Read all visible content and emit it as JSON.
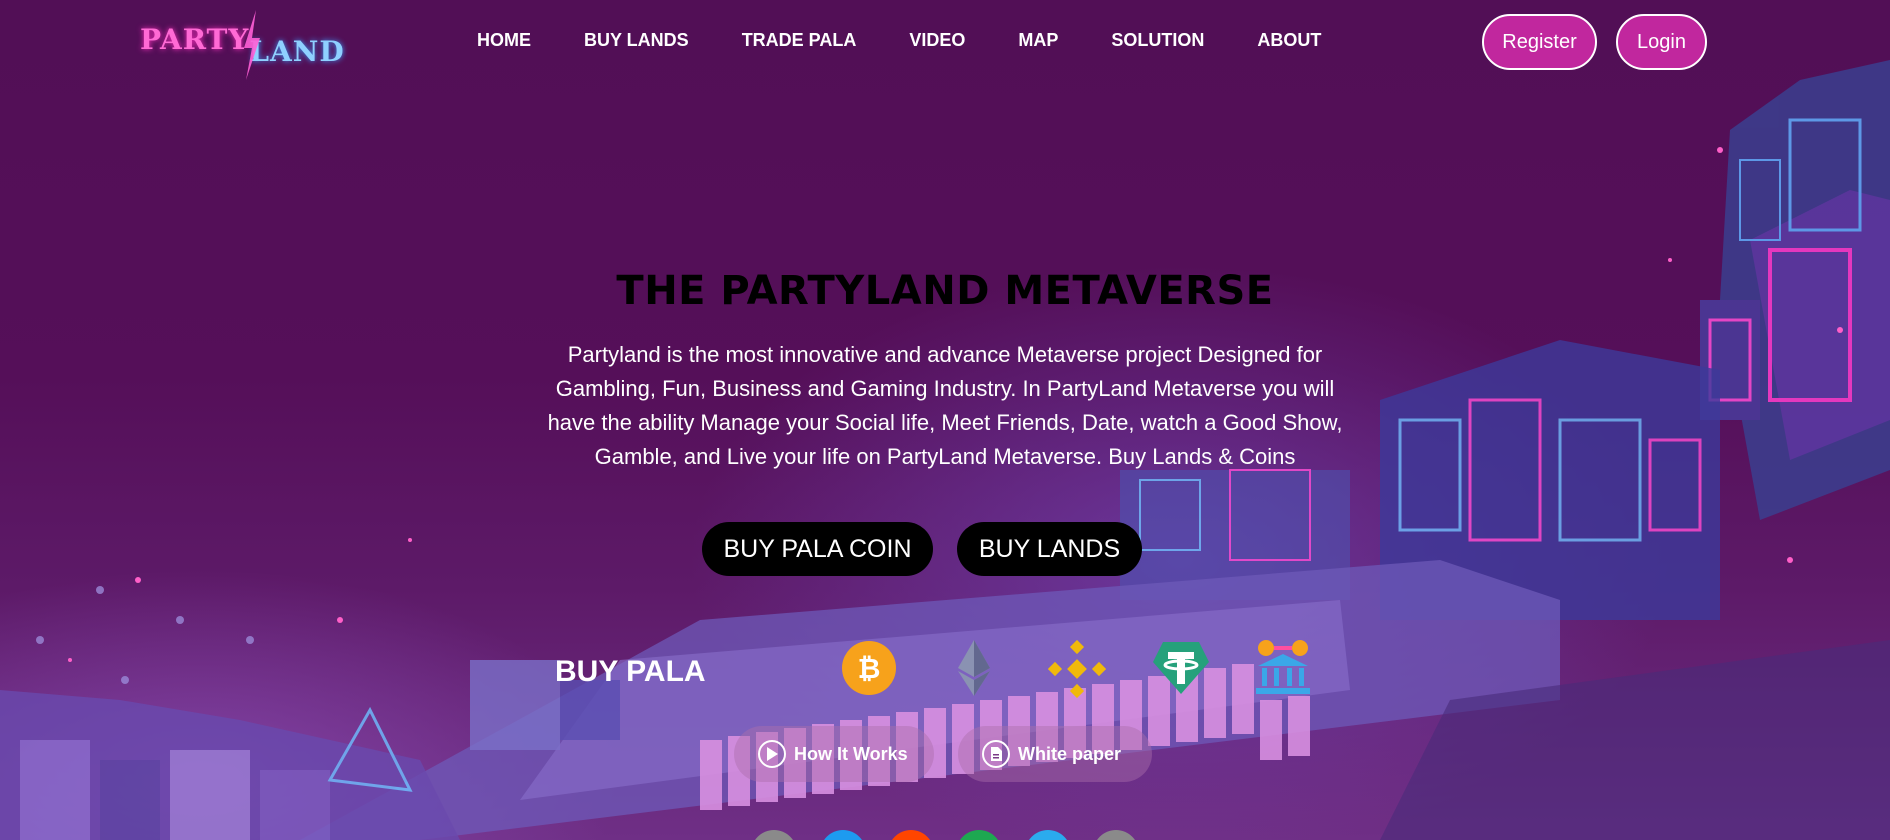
{
  "brand": {
    "word1": "PARTY",
    "word2": "LAND"
  },
  "nav": [
    "HOME",
    "BUY LANDS",
    "TRADE PALA",
    "VIDEO",
    "MAP",
    "SOLUTION",
    "ABOUT"
  ],
  "auth": {
    "register": "Register",
    "login": "Login"
  },
  "hero": {
    "title": "THE PARTYLAND METAVERSE",
    "description": "Partyland is the most innovative and advance Metaverse project Designed for Gambling, Fun, Business and Gaming Industry. In PartyLand Metaverse you will have the ability Manage your Social life, Meet Friends, Date, watch a Good Show, Gamble, and Live your life on PartyLand Metaverse. Buy Lands & Coins",
    "buy_coin": "BUY PALA COIN",
    "buy_lands": "BUY LANDS"
  },
  "payment": {
    "label": "BUY PALA",
    "methods": [
      "bitcoin-icon",
      "ethereum-icon",
      "binance-icon",
      "tether-icon",
      "bank-transfer-icon"
    ]
  },
  "links": {
    "how_it_works": "How It Works",
    "white_paper": "White paper"
  },
  "colors": {
    "background": "#4e0e52",
    "auth_button": "#c1279e",
    "cta_button": "#000000",
    "bitcoin": "#f7a21b",
    "binance": "#f0b90b",
    "tether": "#26a17b"
  }
}
